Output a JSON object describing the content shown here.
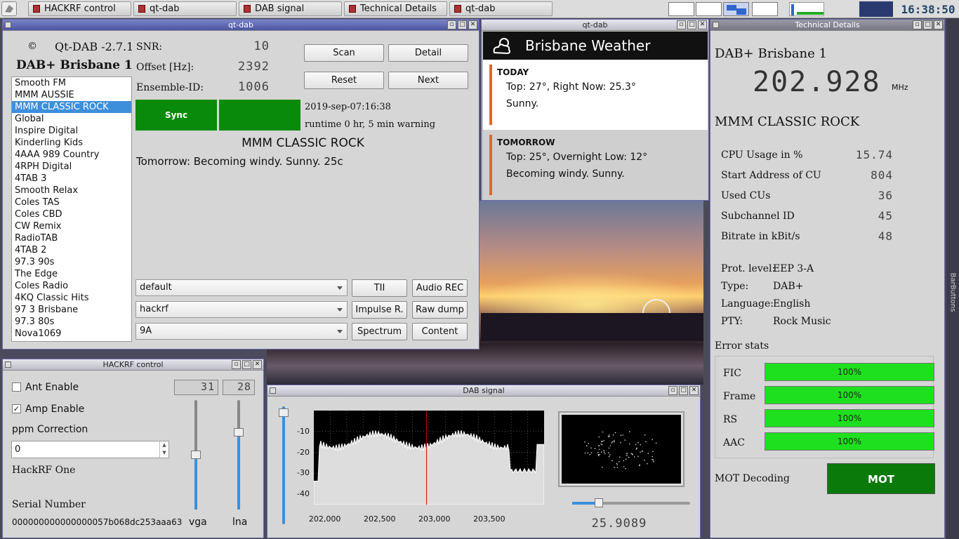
{
  "taskbar": {
    "tasks": [
      {
        "label": "HACKRF control"
      },
      {
        "label": "qt-dab"
      },
      {
        "label": "DAB signal"
      },
      {
        "label": "Technical Details"
      },
      {
        "label": "qt-dab"
      }
    ],
    "clock": "16:38:50"
  },
  "main": {
    "title": "qt-dab",
    "copyright": "©",
    "version": "Qt-DAB -2.7.1",
    "ensemble_name": "DAB+ Brisbane 1",
    "snr_label": "SNR:",
    "snr_value": "10",
    "offset_label": "Offset [Hz]:",
    "offset_value": "2392",
    "ensemble_id_label": "Ensemble-ID:",
    "ensemble_id_value": "1006",
    "scan": "Scan",
    "detail": "Detail",
    "reset": "Reset",
    "next": "Next",
    "sync": "Sync",
    "datetime": "2019-sep-07:16:38",
    "runtime": "runtime 0 hr, 5 min  warning",
    "station": "MMM CLASSIC ROCK",
    "dynamic_label": "Tomorrow: Becoming windy. Sunny. 25c",
    "services": [
      "Smooth FM",
      "MMM AUSSIE",
      "MMM CLASSIC ROCK",
      "Global",
      "Inspire Digital",
      "Kinderling Kids",
      "4AAA 989 Country",
      "4RPH Digital",
      "4TAB 3",
      "Smooth Relax",
      "Coles TAS",
      "Coles CBD",
      "CW Remix",
      "RadioTAB",
      "4TAB 2",
      "97.3 90s",
      "The Edge",
      "Coles Radio",
      "4KQ Classic Hits",
      "97 3 Brisbane",
      "97.3 80s",
      "Nova1069"
    ],
    "selected_service": 2,
    "combo_preset": "default",
    "combo_device": "hackrf",
    "combo_channel": "9A",
    "tii": "TII",
    "audio_rec": "Audio REC",
    "impulse": "Impulse R.",
    "raw_dump": "Raw dump",
    "spectrum": "Spectrum",
    "content": "Content"
  },
  "weather": {
    "title": "qt-dab",
    "heading": "Brisbane Weather",
    "today_label": "TODAY",
    "today_line1": "Top: 27°, Right Now: 25.3°",
    "today_line2": "Sunny.",
    "tomorrow_label": "TOMORROW",
    "tomorrow_line1": "Top: 25°, Overnight Low: 12°",
    "tomorrow_line2": "Becoming windy. Sunny."
  },
  "hackrf": {
    "title": "HACKRF control",
    "ant_enable": "Ant Enable",
    "amp_enable": "Amp Enable",
    "ppm_label": "ppm Correction",
    "ppm_value": "0",
    "device": "HackRF One",
    "serial_label": "Serial Number",
    "serial_value": "000000000000000057b068dc253aaa63",
    "vga_value": "31",
    "lna_value": "28",
    "vga_label": "vga",
    "lna_label": "lna"
  },
  "signal": {
    "title": "DAB signal",
    "y_ticks": [
      "-10",
      "-20",
      "-30",
      "-40"
    ],
    "x_ticks": [
      "202,000",
      "202,500",
      "203,000",
      "203,500"
    ],
    "readout": "25.9089"
  },
  "details": {
    "title": "Technical Details",
    "ensemble": "DAB+ Brisbane 1",
    "frequency": "202.928",
    "freq_unit": "MHz",
    "service": "MMM CLASSIC ROCK",
    "cpu_label": "CPU Usage in %",
    "cpu_value": "15.74",
    "start_label": "Start Address of CU",
    "start_value": "804",
    "used_label": "Used CUs",
    "used_value": "36",
    "subch_label": "Subchannel ID",
    "subch_value": "45",
    "bitrate_label": "Bitrate in kBit/s",
    "bitrate_value": "48",
    "prot_label": "Prot. level:",
    "prot_value": "EEP 3-A",
    "type_label": "Type:",
    "type_value": "DAB+",
    "lang_label": "Language:",
    "lang_value": "English",
    "pty_label": "PTY:",
    "pty_value": "Rock Music",
    "error_stats": "Error stats",
    "fic_label": "FIC",
    "fic_value": "100%",
    "frame_label": "Frame",
    "frame_value": "100%",
    "rs_label": "RS",
    "rs_value": "100%",
    "aac_label": "AAC",
    "aac_value": "100%",
    "mot_label": "MOT Decoding",
    "mot_button": "MOT",
    "sidebar": "BarButtons"
  },
  "chart_data": {
    "type": "area",
    "x_range": [
      201900,
      204000
    ],
    "y_range": [
      -45,
      0
    ],
    "x_ticks": [
      202000,
      202500,
      203000,
      203500
    ],
    "y_ticks": [
      -10,
      -20,
      -30,
      -40
    ],
    "marker_x": 202928
  }
}
